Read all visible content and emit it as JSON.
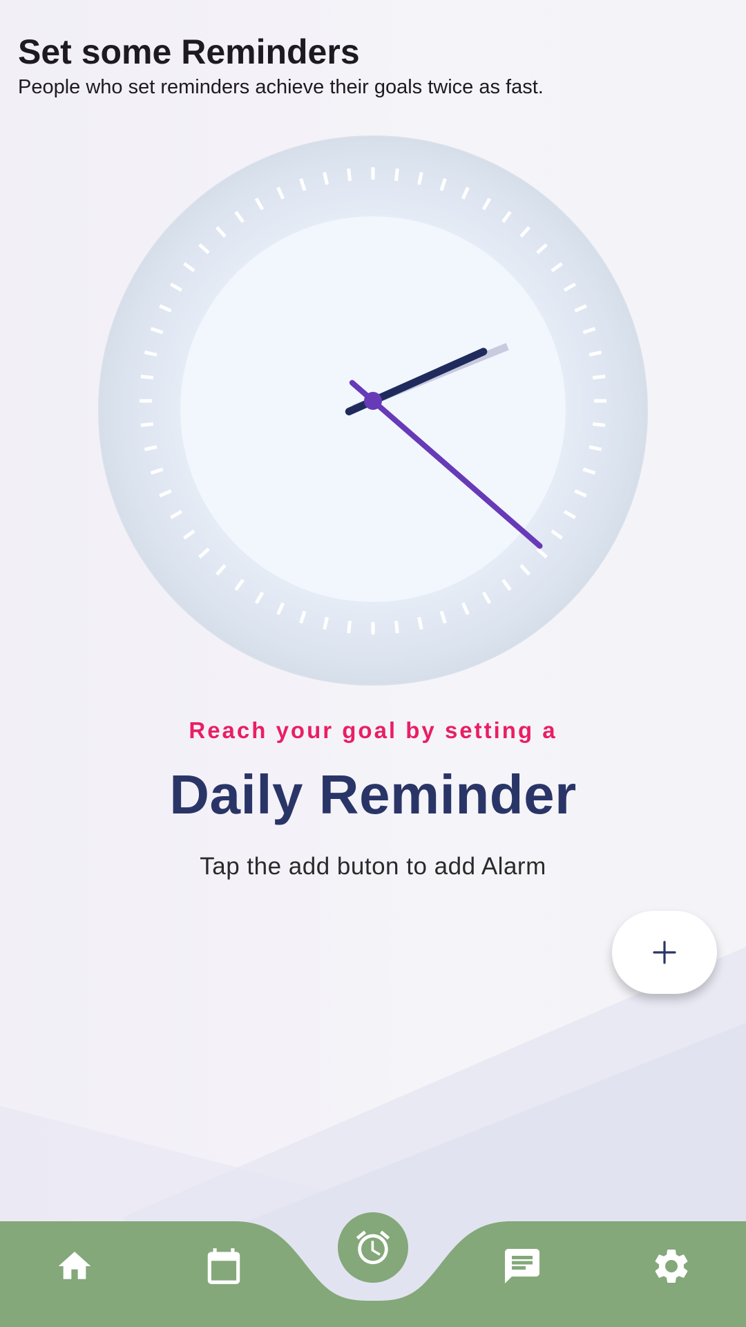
{
  "header": {
    "title": "Set some Reminders",
    "subtitle": "People who set reminders achieve their goals twice as fast."
  },
  "clock": {
    "hour": 2,
    "minute": 22,
    "second": 22,
    "hand_colors": {
      "hour": "#1f2b5c",
      "minute": "#c8cadf",
      "second": "#673ab7"
    }
  },
  "main": {
    "tagline": "Reach your goal by setting a",
    "headline": "Daily Reminder",
    "hint": "Tap the add buton to add Alarm"
  },
  "fab": {
    "icon": "plus-icon",
    "label": "+"
  },
  "nav": {
    "background": "#84a879",
    "items": [
      {
        "id": "home",
        "icon": "home-icon"
      },
      {
        "id": "calendar",
        "icon": "calendar-icon"
      },
      {
        "id": "alarm",
        "icon": "alarm-icon",
        "selected": true
      },
      {
        "id": "messages",
        "icon": "message-icon"
      },
      {
        "id": "settings",
        "icon": "gear-icon"
      }
    ]
  },
  "colors": {
    "accent": "#e91e63",
    "headline": "#2a3567",
    "purple": "#673ab7",
    "nav": "#84a879"
  }
}
